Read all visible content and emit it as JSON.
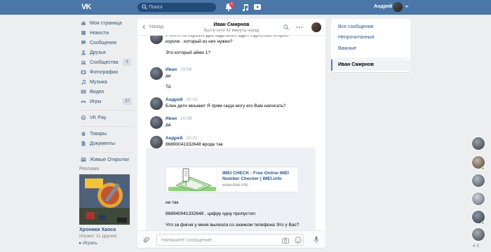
{
  "topbar": {
    "logo": "VK",
    "search_placeholder": "Поиск",
    "notifications_count": "6",
    "user_name": "Андрей"
  },
  "sidebar": {
    "items": [
      {
        "label": "Моя страница",
        "icon": "home-icon"
      },
      {
        "label": "Новости",
        "icon": "news-icon"
      },
      {
        "label": "Сообщения",
        "icon": "messages-icon"
      },
      {
        "label": "Друзья",
        "icon": "friends-icon"
      },
      {
        "label": "Сообщества",
        "icon": "communities-icon",
        "badge": "3"
      },
      {
        "label": "Фотографии",
        "icon": "photos-icon"
      },
      {
        "label": "Музыка",
        "icon": "music-icon"
      },
      {
        "label": "Видео",
        "icon": "video-icon"
      },
      {
        "label": "Игры",
        "icon": "games-icon",
        "badge": "37"
      }
    ],
    "pay": {
      "label": "VK Pay",
      "icon": "vkpay-icon"
    },
    "market": [
      {
        "label": "Товары",
        "icon": "goods-icon"
      },
      {
        "label": "Документы",
        "icon": "documents-icon"
      }
    ],
    "cards": {
      "label": "Живые Открытки",
      "icon": "cards-icon"
    },
    "ads": {
      "title": "Реклама",
      "name": "Хроники Хаоса",
      "sub": "Играют 11 друзей",
      "play": "▸ Играть"
    }
  },
  "chat": {
    "back_label": "Назад",
    "peer_name": "Иван Смирнов",
    "peer_status": "был в сети 42 минуты назад",
    "messages": [
      {
        "lines": [
          "У меня на коробке два кода айме Один с длинный второй",
          "короче . который из них нужен?",
          "Это который айме 1?"
        ]
      },
      {
        "author": "Иван",
        "time": "19:56",
        "lines": [
          "да",
          "Тй"
        ]
      },
      {
        "author": "Андрей",
        "time": "20:03",
        "lines": [
          "Блин дети мишают Я прям сюда могу его Вам написать?"
        ]
      },
      {
        "author": "Иван",
        "time": "20:08",
        "lines": [
          "да"
        ]
      },
      {
        "author": "Андрей",
        "time": "20:22",
        "lines": [
          "86890041332648 вроде так",
          "не так",
          "868940041332648 , цифру одну пропустил",
          "Что за фигня у меня вылезла со значком телефона Это у Вас?"
        ]
      }
    ],
    "link": {
      "title": "IMEI CHECK - Free Online IMEI Number Checker | IMEI.info",
      "url": "www.imei.info"
    },
    "compose_placeholder": "Напишите сообщение..."
  },
  "right_panel": {
    "items": [
      "Все сообщения",
      "Непрочитанные",
      "Важные"
    ],
    "active": "Иван Смирнов"
  },
  "friends_online": {
    "count": "4 ⊻"
  },
  "colors": {
    "header": "#4a76a8",
    "link": "#2a5885",
    "background": "#edeef0",
    "highlight": "#edf0f5"
  }
}
